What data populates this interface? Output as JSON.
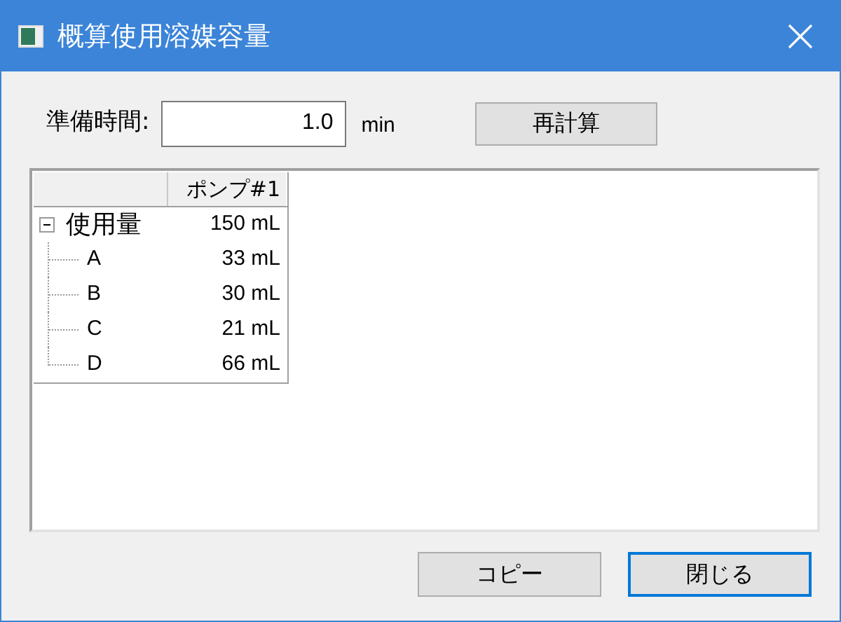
{
  "window": {
    "title": "概算使用溶媒容量"
  },
  "prep_time": {
    "label": "準備時間:",
    "value": "1.0",
    "unit": "min"
  },
  "recalc_button": "再計算",
  "grid": {
    "columns": [
      "ポンプ#1"
    ],
    "rows": [
      {
        "label": "使用量",
        "value": "150 mL",
        "expanded": true,
        "children": [
          {
            "label": "A",
            "value": "33 mL"
          },
          {
            "label": "B",
            "value": "30 mL"
          },
          {
            "label": "C",
            "value": "21 mL"
          },
          {
            "label": "D",
            "value": "66 mL"
          }
        ]
      }
    ]
  },
  "buttons": [
    {
      "label": "コピー",
      "default": false
    },
    {
      "label": "閉じる",
      "default": true
    }
  ]
}
